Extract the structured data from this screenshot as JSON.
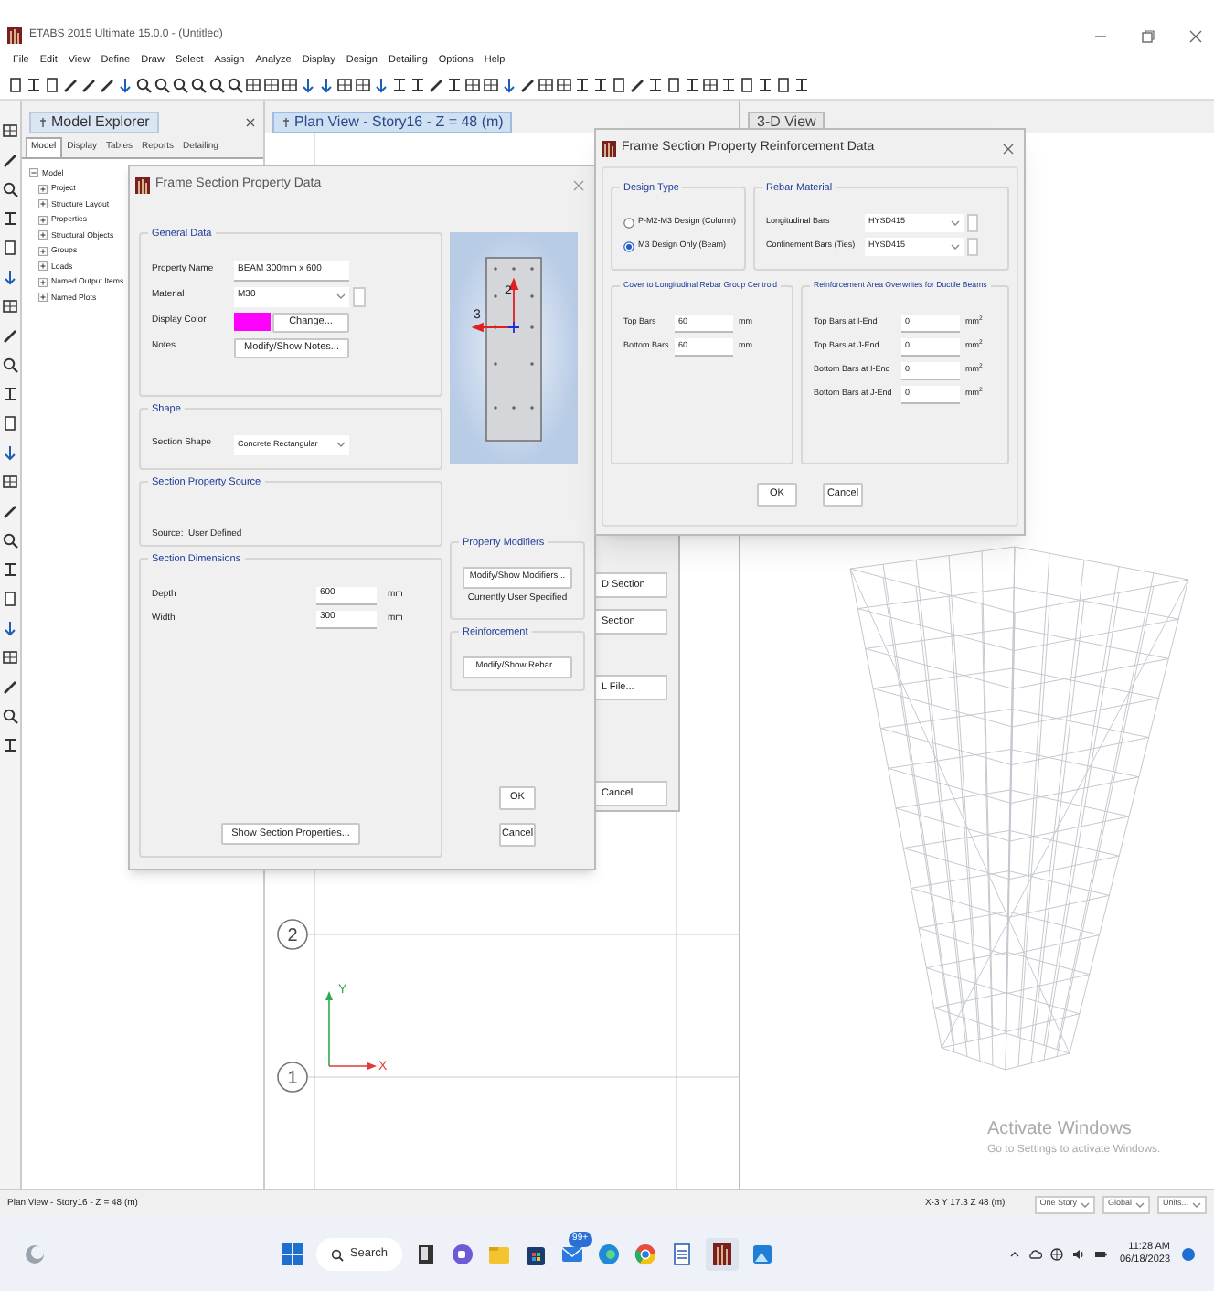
{
  "window": {
    "title": "ETABS 2015 Ultimate 15.0.0 - (Untitled)"
  },
  "menu": [
    "File",
    "Edit",
    "View",
    "Define",
    "Draw",
    "Select",
    "Assign",
    "Analyze",
    "Display",
    "Design",
    "Detailing",
    "Options",
    "Help"
  ],
  "model_explorer": {
    "title": "Model Explorer",
    "tabs": [
      {
        "label": "Model",
        "selected": true
      },
      {
        "label": "Display",
        "selected": false
      },
      {
        "label": "Tables",
        "selected": false
      },
      {
        "label": "Reports",
        "selected": false
      },
      {
        "label": "Detailing",
        "selected": false
      }
    ],
    "tree": [
      {
        "label": "Model",
        "expanded": true,
        "children": [
          {
            "label": "Project",
            "expanded": false
          },
          {
            "label": "Structure Layout",
            "expanded": false
          },
          {
            "label": "Properties",
            "expanded": false
          },
          {
            "label": "Structural Objects",
            "expanded": false
          },
          {
            "label": "Groups",
            "expanded": false
          },
          {
            "label": "Loads",
            "expanded": false
          },
          {
            "label": "Named Output Items",
            "expanded": false
          },
          {
            "label": "Named Plots",
            "expanded": false
          }
        ]
      }
    ]
  },
  "plan_view": {
    "title": "Plan View - Story16 - Z = 48 (m)",
    "grid_labels": [
      "2",
      "1"
    ],
    "axis_labels": [
      "Y",
      "X"
    ]
  },
  "view_3d": {
    "title": "3-D View"
  },
  "background_dialog": {
    "buttons": [
      "D Section",
      "Section",
      "L File...",
      "Cancel"
    ]
  },
  "section_dialog": {
    "title": "Frame Section Property Data",
    "general_data": {
      "title": "General Data",
      "fields": [
        {
          "label": "Property Name",
          "kind": "text",
          "value": "BEAM 300mm x 600"
        },
        {
          "label": "Material",
          "kind": "dropdown",
          "value": "M30"
        },
        {
          "label": "Display Color",
          "kind": "color",
          "color": "#ff00ff",
          "button": "Change..."
        },
        {
          "label": "Notes",
          "kind": "button",
          "button": "Modify/Show Notes..."
        }
      ]
    },
    "shape": {
      "title": "Shape",
      "label": "Section Shape",
      "value": "Concrete Rectangular"
    },
    "source": {
      "title": "Section Property Source",
      "text": "Source:  User Defined"
    },
    "dimensions": {
      "title": "Section Dimensions",
      "rows": [
        {
          "label": "Depth",
          "value": "600",
          "unit": "mm"
        },
        {
          "label": "Width",
          "value": "300",
          "unit": "mm"
        }
      ],
      "button": "Show Section Properties..."
    },
    "preview": {
      "axis_labels": [
        "2",
        "3"
      ]
    },
    "modifiers": {
      "title": "Property Modifiers",
      "button": "Modify/Show Modifiers...",
      "note": "Currently User Specified"
    },
    "reinforcement": {
      "title": "Reinforcement",
      "button": "Modify/Show Rebar..."
    },
    "buttons": [
      "OK",
      "Cancel"
    ]
  },
  "rebar_dialog": {
    "title": "Frame Section Property Reinforcement Data",
    "design_type": {
      "title": "Design Type",
      "options": [
        {
          "label": "P-M2-M3 Design (Column)",
          "selected": false
        },
        {
          "label": "M3 Design Only (Beam)",
          "selected": true
        }
      ]
    },
    "rebar_material": {
      "title": "Rebar Material",
      "rows": [
        {
          "label": "Longitudinal Bars",
          "value": "HYSD415"
        },
        {
          "label": "Confinement Bars (Ties)",
          "value": "HYSD415"
        }
      ]
    },
    "cover": {
      "title": "Cover to Longitudinal Rebar Group Centroid",
      "rows": [
        {
          "label": "Top Bars",
          "value": "60",
          "unit": "mm"
        },
        {
          "label": "Bottom Bars",
          "value": "60",
          "unit": "mm"
        }
      ]
    },
    "overwrites": {
      "title": "Reinforcement Area Overwrites for Ductile Beams",
      "rows": [
        {
          "label": "Top Bars at I-End",
          "value": "0",
          "unit": "mm$^{2}$"
        },
        {
          "label": "Top Bars at J-End",
          "value": "0",
          "unit": "mm$^{2}$"
        },
        {
          "label": "Bottom Bars at I-End",
          "value": "0",
          "unit": "mm$^{2}$"
        },
        {
          "label": "Bottom Bars at J-End",
          "value": "0",
          "unit": "mm$^{2}$"
        }
      ]
    },
    "buttons": [
      "OK",
      "Cancel"
    ]
  },
  "activation_notice": {
    "title": "Activate Windows",
    "text": "Go to Settings to activate Windows."
  },
  "status_bar": {
    "view": "Plan View - Story16 - Z = 48 (m)",
    "coordinates": "X-3 Y 17.3 Z 48 (m)",
    "dropdowns": [
      "One Story",
      "Global",
      "Units..."
    ]
  },
  "taskbar": {
    "search": "Search",
    "badge": "99+",
    "time": "11:28 AM",
    "date": "06/18/2023"
  }
}
